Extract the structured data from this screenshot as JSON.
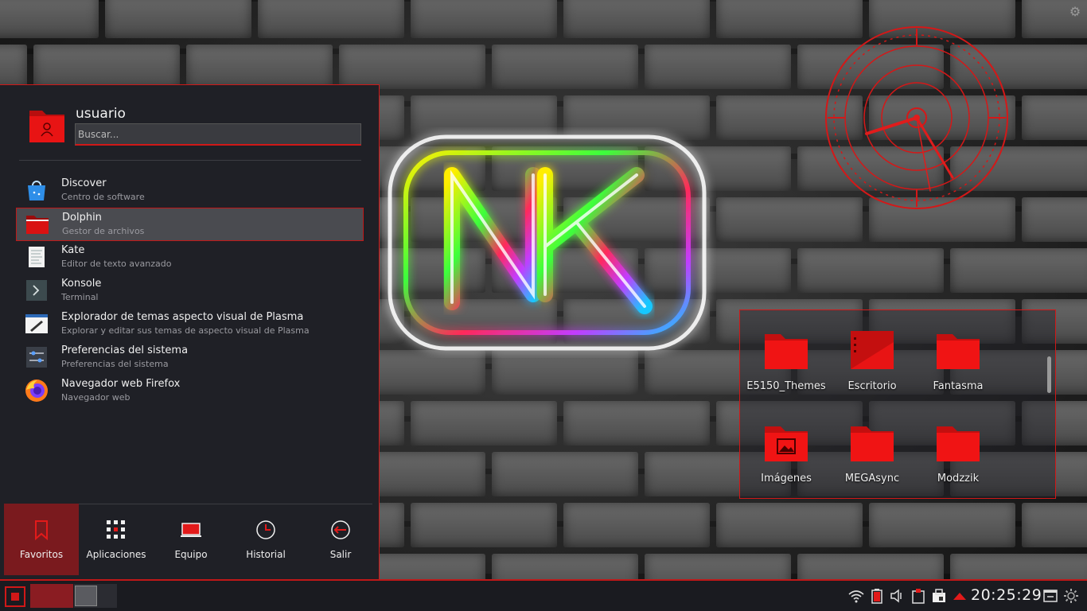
{
  "launcher": {
    "username": "usuario",
    "search_placeholder": "Buscar...",
    "apps": [
      {
        "name": "Discover",
        "desc": "Centro de software",
        "icon": "discover-icon"
      },
      {
        "name": "Dolphin",
        "desc": "Gestor de archivos",
        "icon": "dolphin-folder-icon",
        "selected": true
      },
      {
        "name": "Kate",
        "desc": "Editor de texto avanzado",
        "icon": "kate-icon"
      },
      {
        "name": "Konsole",
        "desc": "Terminal",
        "icon": "konsole-icon"
      },
      {
        "name": "Explorador de temas aspecto visual de Plasma",
        "desc": "Explorar y editar sus temas de aspecto visual de Plasma",
        "icon": "theme-explorer-icon"
      },
      {
        "name": "Preferencias del sistema",
        "desc": "Preferencias del sistema",
        "icon": "settings-icon"
      },
      {
        "name": "Navegador web Firefox",
        "desc": "Navegador web",
        "icon": "firefox-icon"
      }
    ],
    "tabs": [
      {
        "label": "Favoritos",
        "icon": "bookmark-icon",
        "active": true
      },
      {
        "label": "Aplicaciones",
        "icon": "apps-grid-icon"
      },
      {
        "label": "Equipo",
        "icon": "computer-icon"
      },
      {
        "label": "Historial",
        "icon": "history-clock-icon"
      },
      {
        "label": "Salir",
        "icon": "logout-icon"
      }
    ]
  },
  "folder_view": {
    "items": [
      "E5150_Themes",
      "Escritorio",
      "Fantasma",
      "Imágenes",
      "MEGAsync",
      "Modzzik"
    ]
  },
  "taskbar": {
    "time": "20:25:29",
    "tray_icons": [
      "wifi-icon",
      "battery-icon",
      "volume-icon",
      "clipboard-icon",
      "device-notifier-icon",
      "updates-arrow-icon",
      "show-desktop-icon",
      "panel-settings-icon"
    ]
  },
  "colors": {
    "accent": "#d01818",
    "panel": "#1f2026",
    "active_tab": "#7a1a1e"
  }
}
